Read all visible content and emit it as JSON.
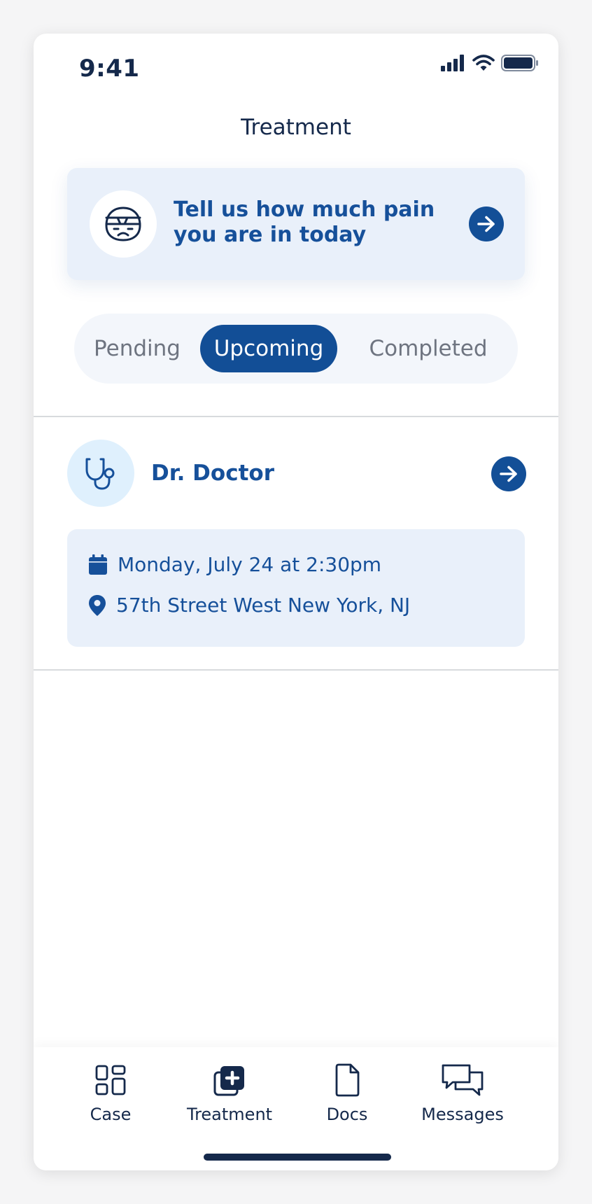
{
  "status_bar": {
    "time": "9:41",
    "icons": [
      "cellular-signal-icon",
      "wifi-icon",
      "battery-icon"
    ]
  },
  "header": {
    "title": "Treatment"
  },
  "pain_prompt": {
    "text": "Tell us how much pain you are in today",
    "icon": "bandaged-face-icon",
    "action_icon": "arrow-right-icon"
  },
  "tabs": {
    "items": [
      {
        "label": "Pending",
        "active": false
      },
      {
        "label": "Upcoming",
        "active": true
      },
      {
        "label": "Completed",
        "active": false
      }
    ]
  },
  "appointment": {
    "doctor_name": "Dr. Doctor",
    "doctor_icon": "stethoscope-icon",
    "datetime": "Monday, July 24 at 2:30pm",
    "location": "57th Street West New York, NJ"
  },
  "bottom_nav": {
    "items": [
      {
        "label": "Case",
        "icon": "grid-icon"
      },
      {
        "label": "Treatment",
        "icon": "medical-cards-icon"
      },
      {
        "label": "Docs",
        "icon": "document-icon"
      },
      {
        "label": "Messages",
        "icon": "chat-bubbles-icon"
      }
    ]
  },
  "colors": {
    "primary": "#134f97",
    "primary_text": "#16509a",
    "dark_text": "#15294b",
    "card_background": "#e9f0fa",
    "avatar_background": "#dff0fd",
    "muted_text": "#6e7480"
  }
}
